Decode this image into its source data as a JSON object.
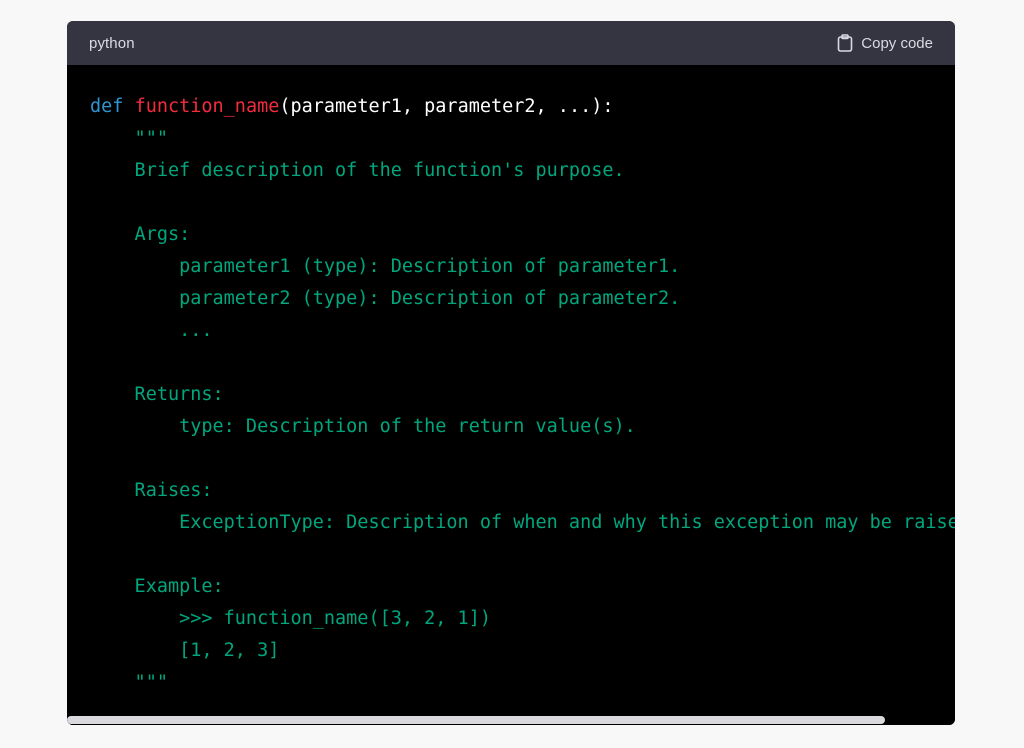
{
  "header": {
    "language": "python",
    "copy_label": "Copy code"
  },
  "code": {
    "line1": {
      "keyword": "def",
      "function_name": "function_name",
      "signature": "(parameter1, parameter2, ...):"
    },
    "docstring": "    \"\"\"\n    Brief description of the function's purpose.\n\n    Args:\n        parameter1 (type): Description of parameter1.\n        parameter2 (type): Description of parameter2.\n        ...\n\n    Returns:\n        type: Description of the return value(s).\n\n    Raises:\n        ExceptionType: Description of when and why this exception may be raised.\n\n    Example:\n        >>> function_name([3, 2, 1])\n        [1, 2, 3]\n    \"\"\""
  },
  "scrollbar": {
    "position_fraction": 0.0
  },
  "colors": {
    "keyword": "#2e95d3",
    "function_name": "#f22c3d",
    "docstring": "#00a67d",
    "header_background": "#343541",
    "code_background": "#000000"
  }
}
